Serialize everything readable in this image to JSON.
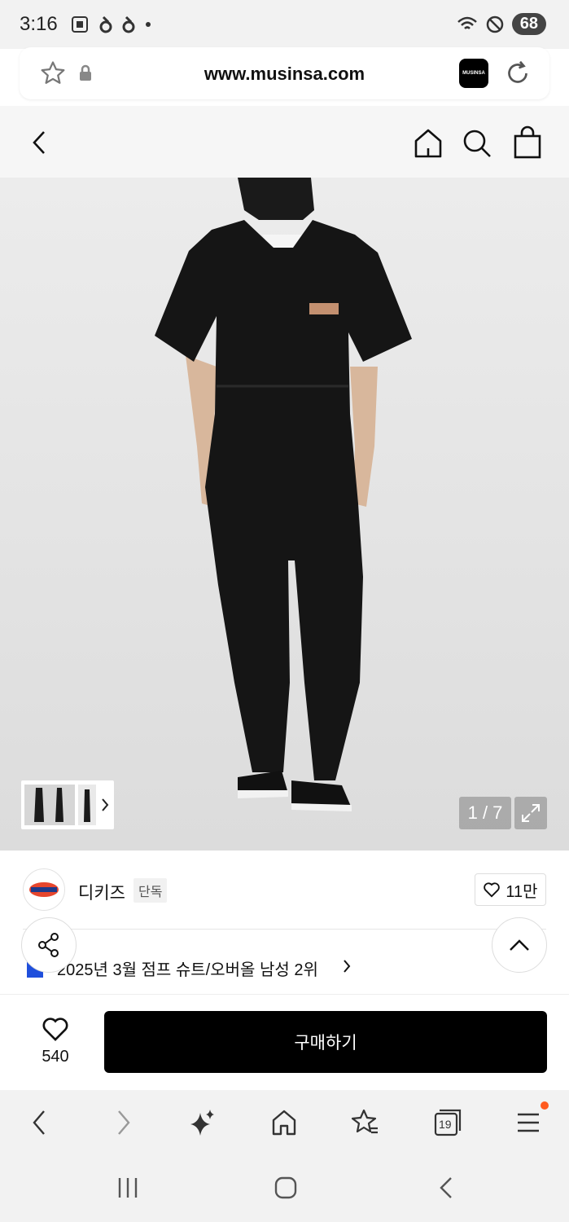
{
  "status": {
    "time": "3:16",
    "battery": "68"
  },
  "browser": {
    "url": "www.musinsa.com",
    "site_badge": "MUSINSA",
    "tabs_count": "19"
  },
  "product": {
    "image_counter": "1 / 7",
    "brand_name": "디키즈",
    "brand_badge": "단독",
    "likes": "11만",
    "ranking_text": "2025년 3월 점프 슈트/오버올 남성 2위",
    "wishlist_count": "540",
    "buy_label": "구매하기"
  },
  "colors": {
    "buy_button": "#000000",
    "notification_dot": "#ff5a1f",
    "rank_flag": "#1f4fdc"
  }
}
